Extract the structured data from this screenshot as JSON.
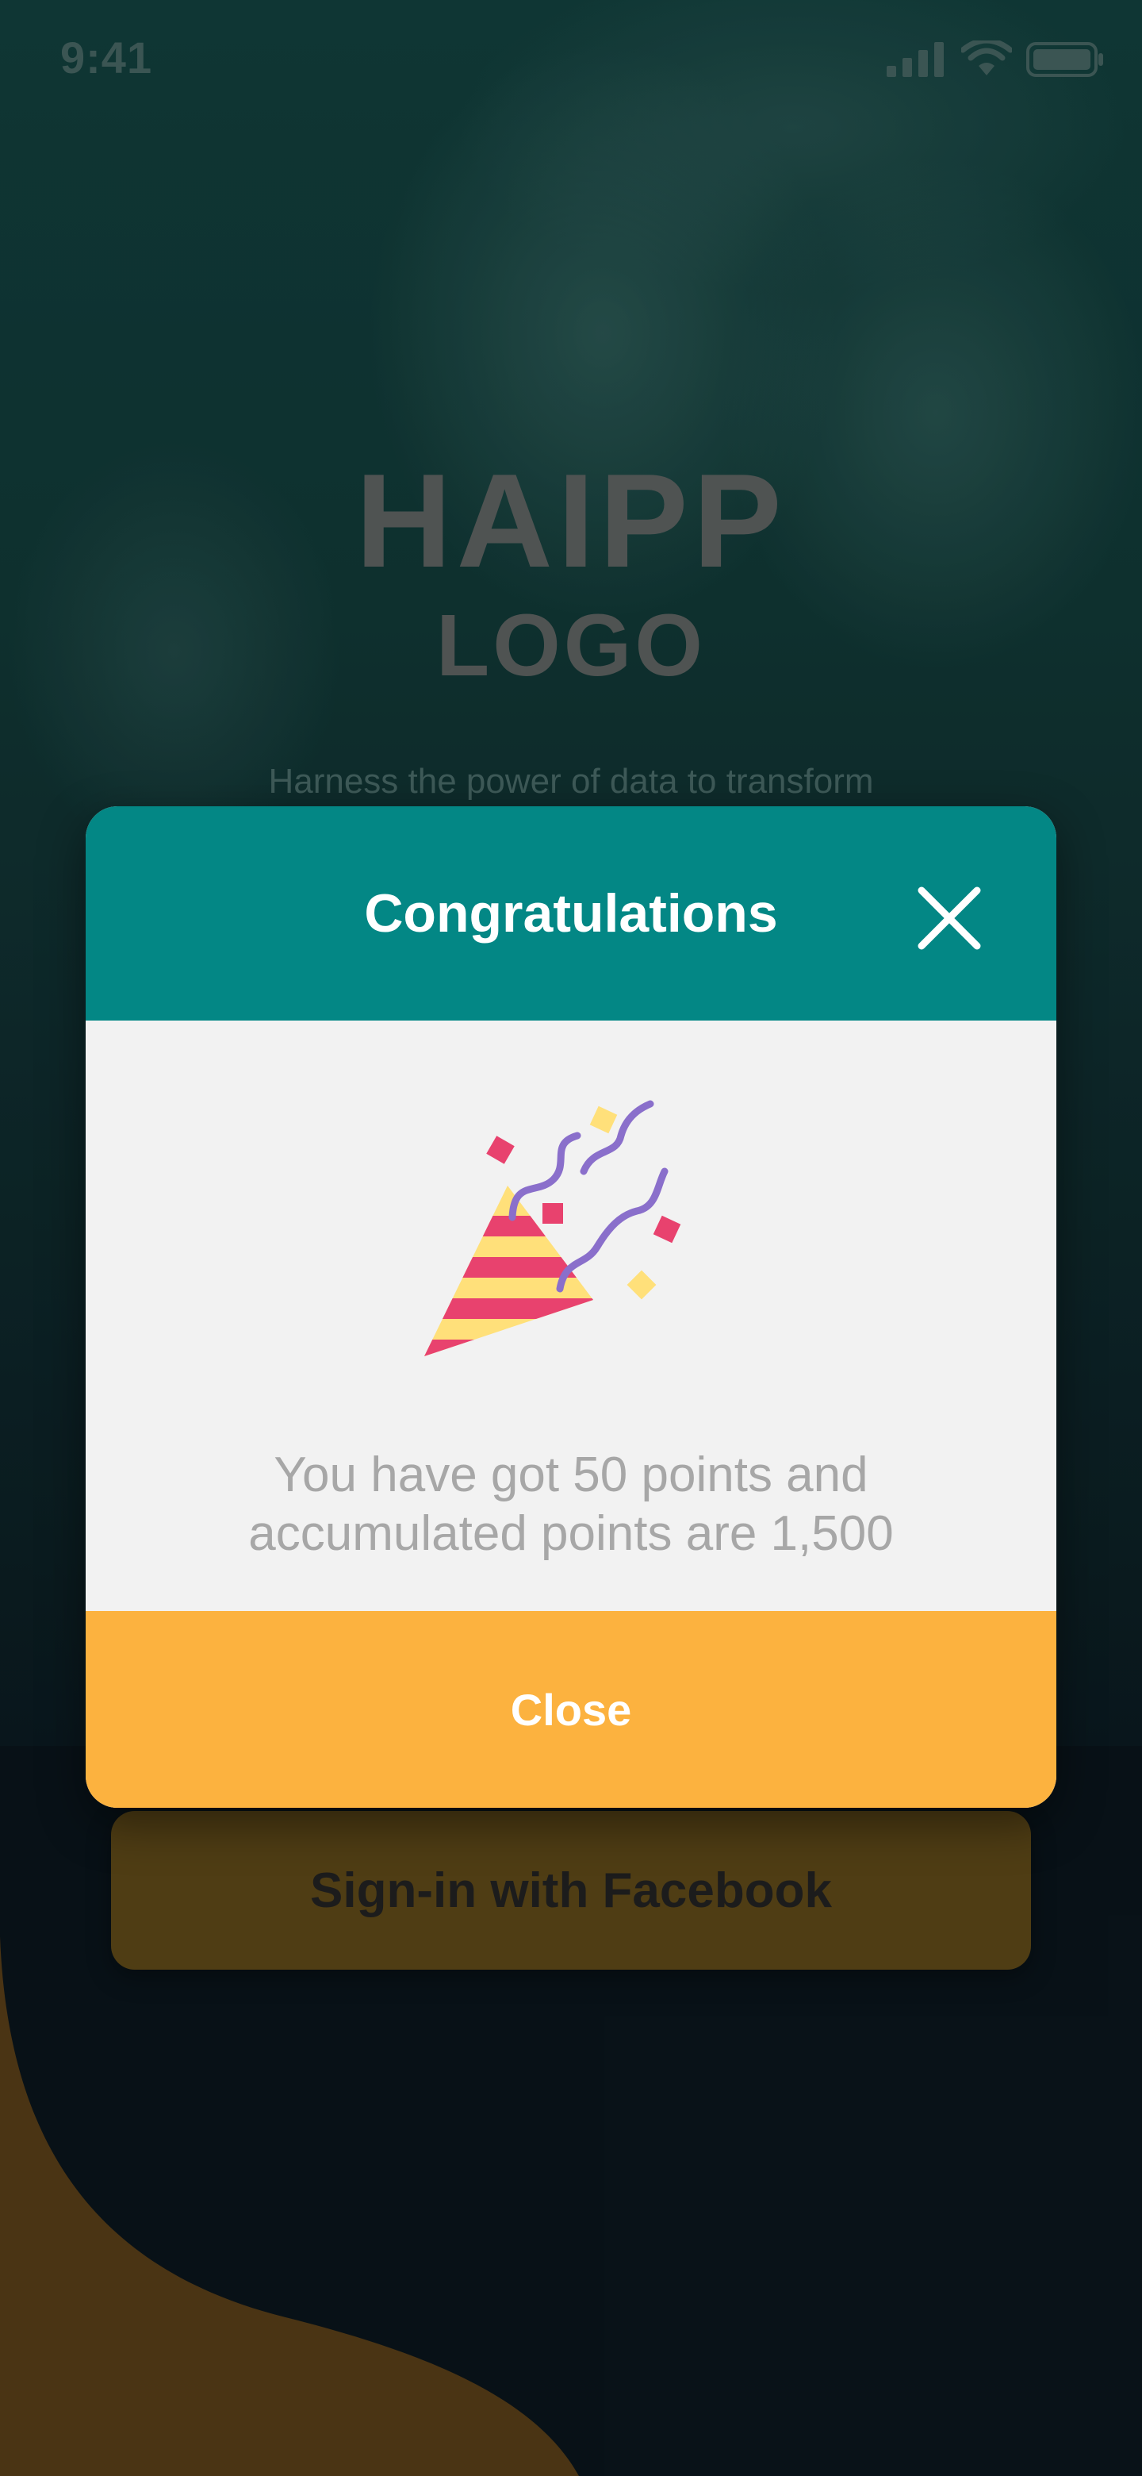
{
  "status_bar": {
    "time": "9:41"
  },
  "brand": {
    "title": "HAIPP",
    "subtitle": "LOGO",
    "tagline": "Harness the power of data to transform"
  },
  "login": {
    "facebook_label": "Sign-in with Facebook"
  },
  "dialog": {
    "title": "Congratulations",
    "message_line1": "You have got 50 points and",
    "message_line2": "accumulated points are 1,500",
    "close_label": "Close",
    "icon": "party-popper-icon"
  },
  "colors": {
    "header_teal": "#038785",
    "footer_amber": "#FCB23F",
    "body_gray": "#F2F2F2",
    "message_text": "#A7A7A7",
    "bottom_wave": "#4A3414"
  }
}
